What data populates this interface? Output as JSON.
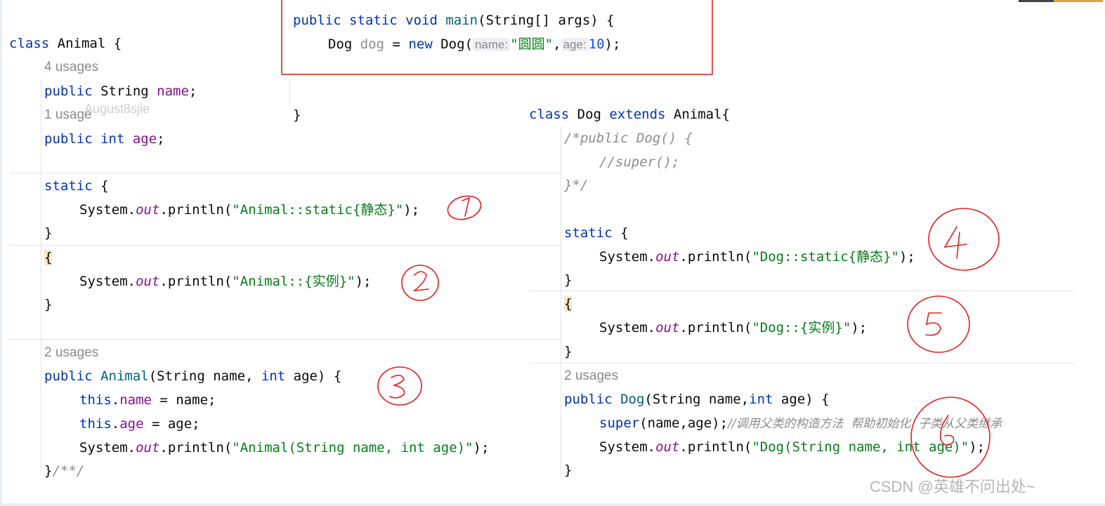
{
  "main_snippet": {
    "line1_kw": "public static void",
    "line1_method": "main",
    "line1_rest": "(String[] args) {",
    "line2_type": "Dog",
    "line2_var": "dog",
    "line2_eq": " = ",
    "line2_new": "new",
    "line2_ctor": " Dog(",
    "hint_name": "name:",
    "arg_name": "\"圆圆\"",
    "comma": ",",
    "hint_age": "age:",
    "arg_age": "10",
    "line2_end": ");",
    "close_brace": "}"
  },
  "animal_class": {
    "header_kw": "class",
    "header_name": " Animal {",
    "usages_name": "4 usages",
    "field_name_kw": "public",
    "field_name_type": " String ",
    "field_name": "name",
    "semi": ";",
    "usages_age": "1 usage",
    "field_age_kw": "public int",
    "field_age": "age",
    "static_kw": "static",
    "open_brace": " {",
    "sys": "System.",
    "out": "out",
    "println": ".println(",
    "str_static": "\"Animal::static{静态}\"",
    "str_instance": "\"Animal::{实例}\"",
    "str_ctor": "\"Animal(String name, int age)\"",
    "end_call": ");",
    "close": "}",
    "brace": "{",
    "usages_ctor": "2 usages",
    "ctor_kw": "public",
    "ctor_name": "Animal",
    "ctor_params_a": "(String name, ",
    "ctor_params_int": "int",
    "ctor_params_b": " age) {",
    "this_kw": "this",
    "dot": ".",
    "assign_name": " = name;",
    "assign_age": " = age;",
    "end_comment": "/**/"
  },
  "dog_class": {
    "header_kw": "class",
    "header_name": " Dog ",
    "extends_kw": "extends",
    "header_parent": " Animal{",
    "comment1": "/*public Dog() {",
    "comment2": "//super();",
    "comment3": "}*/",
    "static_kw": "static",
    "open_brace": " {",
    "sys": "System.",
    "out": "out",
    "println": ".println(",
    "str_static": "\"Dog::static{静态}\"",
    "str_instance": "\"Dog::{实例}\"",
    "str_ctor": "\"Dog(String name, int age)\"",
    "end_call": ");",
    "close": "}",
    "brace": "{",
    "usages_ctor": "2 usages",
    "ctor_kw": "public",
    "ctor_name": "Dog",
    "ctor_params_a": "(String name,",
    "ctor_params_int": "int",
    "ctor_params_b": " age) {",
    "super_kw": "super",
    "super_args": "(name,age);",
    "super_comment": "//调用父类的构造方法  帮助初始化  子类从父类继承"
  },
  "watermark": "August8sjie",
  "annotations": [
    "1",
    "2",
    "3",
    "4",
    "5",
    "6"
  ],
  "footer": "CSDN @英雄不问出处~",
  "colors": {
    "keyword": "#0033b3",
    "field": "#871094",
    "string": "#067d17",
    "number": "#1750eb",
    "annotation_ink": "#e02020",
    "frame": "#d9534f"
  }
}
